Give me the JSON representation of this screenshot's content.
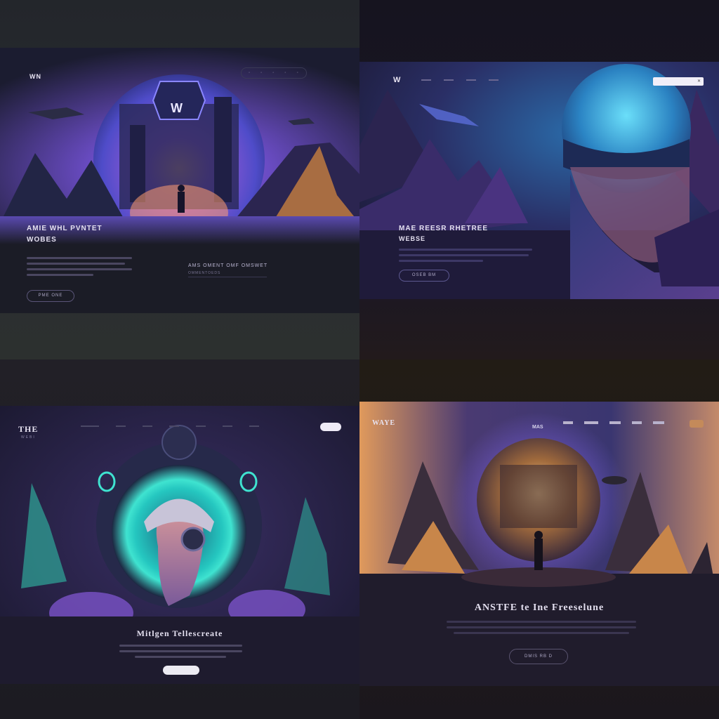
{
  "panels": [
    {
      "logo": "WN",
      "nav": [
        "◦",
        "◦",
        "◦",
        "◦",
        "◦"
      ],
      "emblem": "W",
      "headline_line1": "AMIE WHL PVNTET",
      "headline_line2": "WOBES",
      "sub_title": "AMS OMENT OMF OMSWET",
      "sub_caption": "OMMENTOEDS",
      "cta": "PME ONE"
    },
    {
      "logo": "W",
      "search_placeholder": "",
      "headline_line1": "MAE REESR RHETREE",
      "headline_line2": "WEBSE",
      "cta": "OSEB BM"
    },
    {
      "logo": "THE",
      "logo_sub": "WEBI",
      "nav_pill": "",
      "headline": "Mitlgen Tellescreate",
      "cta": ""
    },
    {
      "logo": "WAYE",
      "badge": "MAS",
      "headline": "ANSTFE te Ine Freeselune",
      "cta": "DMIS RB D"
    }
  ],
  "colors": {
    "accent_purple": "#8a6cff",
    "accent_teal": "#3fe3d0",
    "accent_orange": "#f0a35a"
  }
}
